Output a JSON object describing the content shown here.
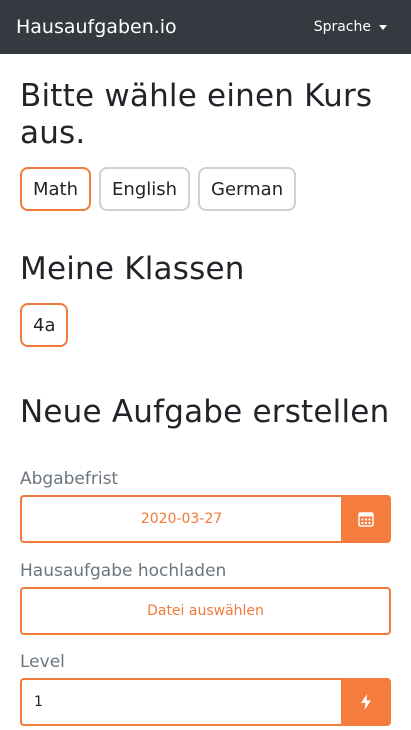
{
  "navbar": {
    "brand": "Hausaufgaben.io",
    "language_label": "Sprache"
  },
  "courses": {
    "heading": "Bitte wähle einen Kurs aus.",
    "items": [
      {
        "label": "Math",
        "selected": true
      },
      {
        "label": "English",
        "selected": false
      },
      {
        "label": "German",
        "selected": false
      }
    ]
  },
  "classes": {
    "heading": "Meine Klassen",
    "items": [
      {
        "label": "4a",
        "selected": true
      }
    ]
  },
  "new_assignment": {
    "heading": "Neue Aufgabe erstellen",
    "due_date": {
      "label": "Abgabefrist",
      "value": "2020-03-27",
      "icon": "calendar-icon"
    },
    "upload": {
      "label": "Hausaufgabe hochladen",
      "button": "Datei auswählen"
    },
    "level": {
      "label": "Level",
      "value": "1",
      "icon": "lightning-icon"
    }
  },
  "colors": {
    "accent": "#f07a3a",
    "navbar": "#343a40"
  }
}
